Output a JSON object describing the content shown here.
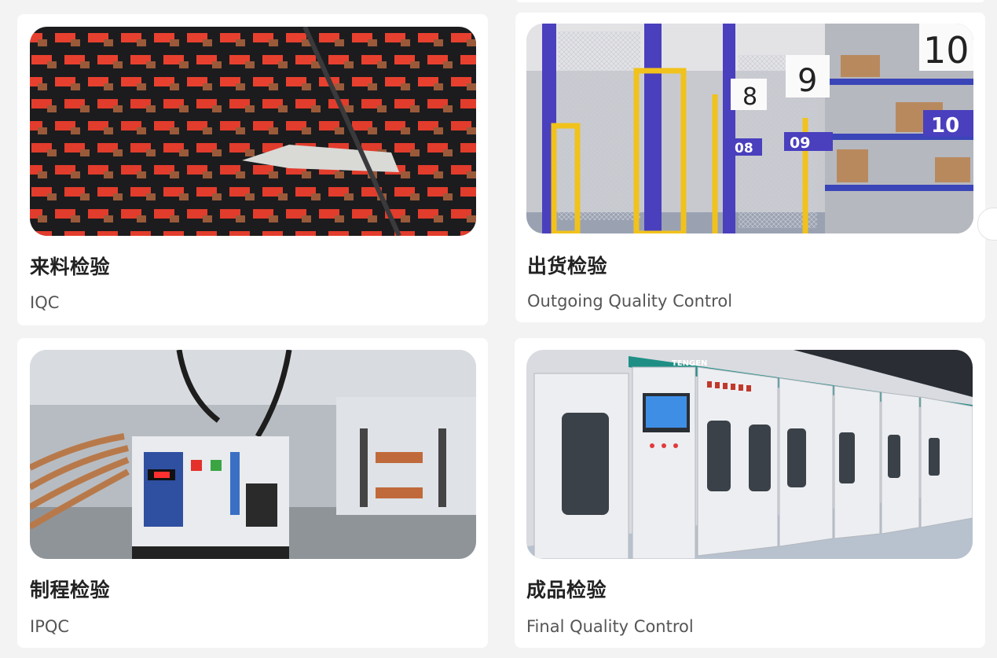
{
  "cards": [
    {
      "title": "来料检验",
      "subtitle": "IQC",
      "image_icon": "component-tray-photo"
    },
    {
      "title": "出货检验",
      "subtitle": "Outgoing Quality Control",
      "image_icon": "warehouse-shelving-photo"
    },
    {
      "title": "制程检验",
      "subtitle": "IPQC",
      "image_icon": "circuit-breaker-assembly-photo"
    },
    {
      "title": "成品检验",
      "subtitle": "Final Quality Control",
      "image_icon": "switchgear-cabinets-photo"
    }
  ],
  "warehouse_labels": [
    "8",
    "9",
    "10",
    "08",
    "09",
    "10"
  ],
  "cabinet_brand": "TENGEN",
  "colors": {
    "background": "#f3f3f3",
    "card": "#ffffff",
    "title": "#222222",
    "subtitle": "#555555"
  }
}
